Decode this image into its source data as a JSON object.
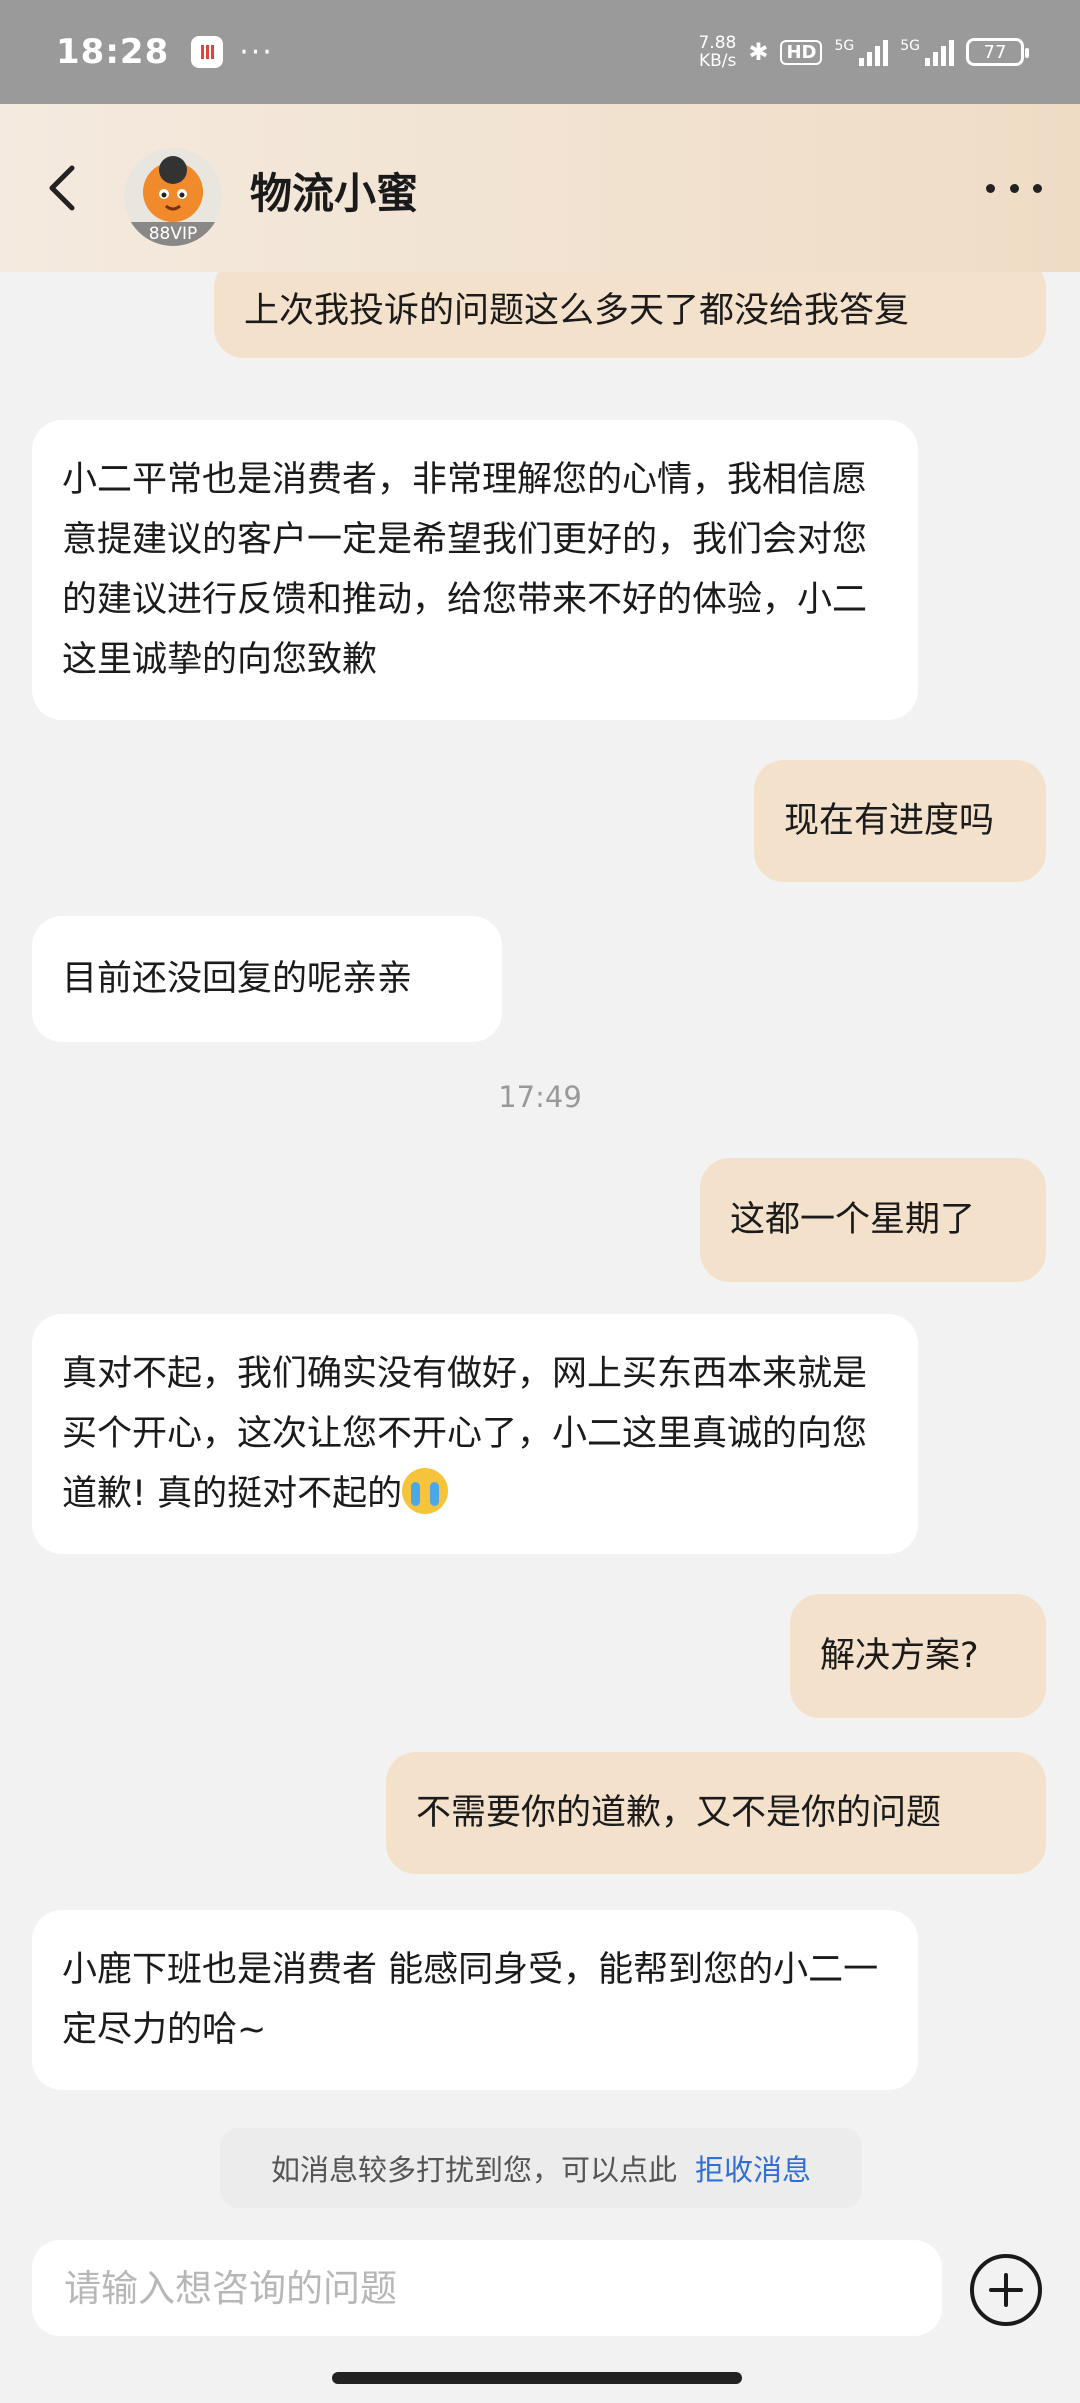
{
  "status_bar": {
    "time": "18:28",
    "dots": "···",
    "net_speed_value": "7.88",
    "net_speed_unit": "KB/s",
    "bluetooth_icon": "bluetooth-icon",
    "hd_label": "HD",
    "signal1_label": "5G",
    "signal2_label": "5G",
    "battery": "77"
  },
  "header": {
    "title": "物流小蜜",
    "avatar_badge": "88VIP",
    "back_icon": "chevron-left-icon",
    "more_icon": "more-dots-icon"
  },
  "messages": [
    {
      "side": "me",
      "text": "上次我投诉的问题这么多天了都没给我答复"
    },
    {
      "side": "them",
      "text": "小二平常也是消费者，非常理解您的心情，我相信愿意提建议的客户一定是希望我们更好的，我们会对您的建议进行反馈和推动，给您带来不好的体验，小二这里诚挚的向您致歉"
    },
    {
      "side": "me",
      "text": "现在有进度吗"
    },
    {
      "side": "them",
      "text": "目前还没回复的呢亲亲"
    },
    {
      "side": "time",
      "text": "17:49"
    },
    {
      "side": "me",
      "text": "这都一个星期了"
    },
    {
      "side": "them",
      "text": "真对不起，我们确实没有做好，网上买东西本来就是买个开心，这次让您不开心了，小二这里真诚的向您道歉! 真的挺对不起的"
    },
    {
      "side": "me",
      "text": "解决方案?"
    },
    {
      "side": "me",
      "text": "不需要你的道歉，又不是你的问题"
    },
    {
      "side": "them",
      "text": "小鹿下班也是消费者 能感同身受，能帮到您的小二一定尽力的哈~"
    }
  ],
  "notice": {
    "text": "如消息较多打扰到您，可以点此",
    "link": "拒收消息"
  },
  "input": {
    "placeholder": "请输入想咨询的问题",
    "plus_icon": "plus-circle-icon"
  },
  "colors": {
    "my_bubble": "#f3e1cb",
    "their_bubble": "#ffffff",
    "link": "#2f6fd6",
    "header_gradient_start": "#f4eadf",
    "header_gradient_end": "#efdcc5"
  }
}
